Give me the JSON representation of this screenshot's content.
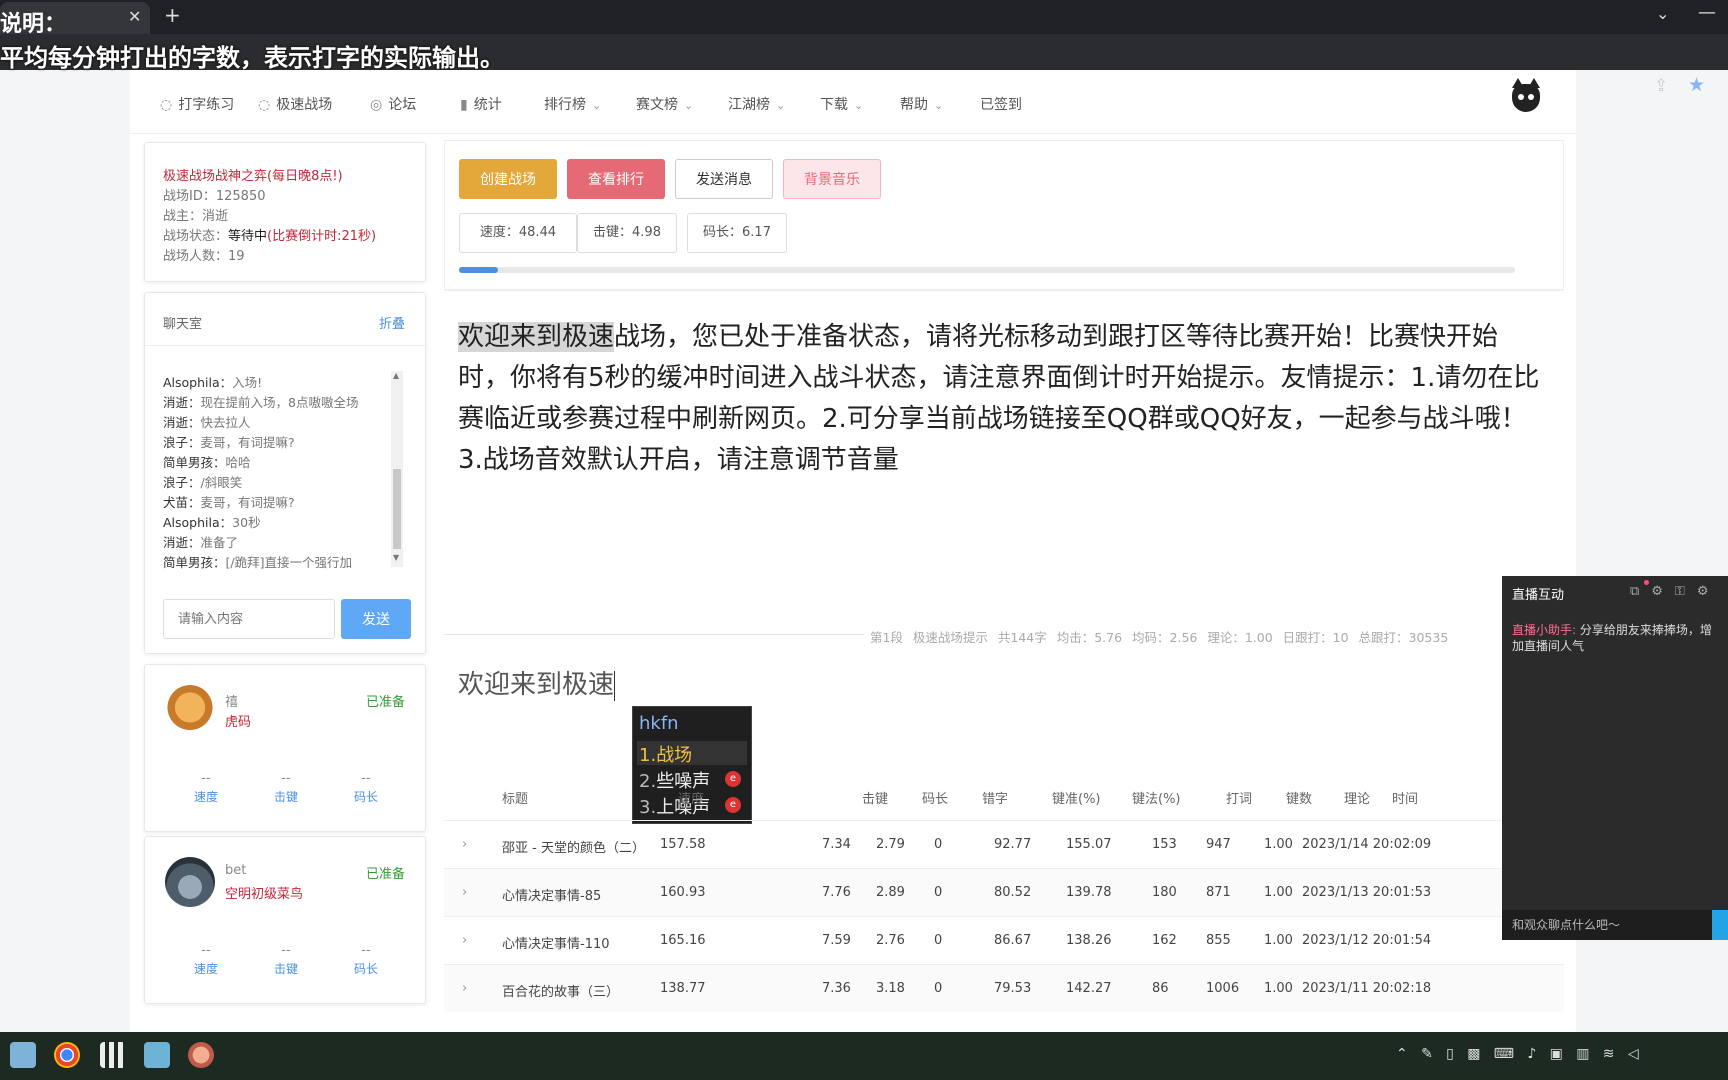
{
  "browser": {
    "tab_title": "说明：",
    "overlay_subtitle": "平均每分钟打出的字数，表示打字的实际输出。",
    "new_tab": "+",
    "close": "✕"
  },
  "nav": {
    "items": [
      {
        "label": "打字练习",
        "icon": "◌"
      },
      {
        "label": "极速战场",
        "icon": "◌"
      },
      {
        "label": "论坛",
        "icon": "◎"
      },
      {
        "label": "统计",
        "icon": "▮"
      },
      {
        "label": "排行榜",
        "chev": true
      },
      {
        "label": "赛文榜",
        "chev": true
      },
      {
        "label": "江湖榜",
        "chev": true
      },
      {
        "label": "下载",
        "chev": true
      },
      {
        "label": "帮助",
        "chev": true
      },
      {
        "label": "已签到"
      }
    ]
  },
  "battle": {
    "name": "极速战场战神之弈(每日晚8点!)",
    "id_label": "战场ID：",
    "id_value": "125850",
    "owner_label": "战主：",
    "owner_value": "消逝",
    "status_label": "战场状态：",
    "status_value": "等待中",
    "countdown": "(比赛倒计时:21秒)",
    "count_label": "战场人数：",
    "count_value": "19"
  },
  "chat": {
    "title": "聊天室",
    "fold": "折叠",
    "messages": [
      {
        "who": "Alsophila",
        "text": "入场!"
      },
      {
        "who": "消逝",
        "text": "现在提前入场，8点嗷嗷全场"
      },
      {
        "who": "消逝",
        "text": "快去拉人"
      },
      {
        "who": "浪子",
        "text": "麦哥，有词提嘛?"
      },
      {
        "who": "简单男孩",
        "text": "哈哈"
      },
      {
        "who": "浪子",
        "text": "/斜眼笑"
      },
      {
        "who": "犬苗",
        "text": "麦哥，有词提嘛?"
      },
      {
        "who": "Alsophila",
        "text": "30秒"
      },
      {
        "who": "消逝",
        "text": "准备了"
      },
      {
        "who": "简单男孩",
        "text": "[/跪拜]直接一个强行加"
      }
    ],
    "input_placeholder": "请输入内容",
    "send": "发送"
  },
  "players": [
    {
      "name": "禧",
      "title": "虎码",
      "status": "已准备",
      "speed": "--",
      "keystroke": "--",
      "code_len": "--"
    },
    {
      "name": "bet",
      "title": "空明初级菜鸟",
      "status": "已准备",
      "speed": "--",
      "keystroke": "--",
      "code_len": "--"
    }
  ],
  "player_stat_labels": {
    "speed": "速度",
    "keystroke": "击键",
    "code_len": "码长"
  },
  "actions": {
    "create": "创建战场",
    "rank": "查看排行",
    "message": "发送消息",
    "music": "背景音乐"
  },
  "metrics": {
    "speed": "速度：48.44",
    "keystroke": "击键：4.98",
    "code_len": "码长：6.17"
  },
  "progress": 0.037,
  "article": {
    "typed": "欢迎来到极速",
    "rest": "战场，您已处于准备状态，请将光标移动到跟打区等待比赛开始！比赛快开始时，你将有5秒的缓冲时间进入战斗状态，请注意界面倒计时开始提示。友情提示：1.请勿在比赛临近或参赛过程中刷新网页。2.可分享当前战场链接至QQ群或QQ好友，一起参与战斗哦！3.战场音效默认开启，请注意调节音量",
    "meta": "第1段  极速战场提示  共144字  均击：5.76  均码：2.56  理论：1.00  日跟打：10  总跟打：30535"
  },
  "typing": {
    "text": "欢迎来到极速"
  },
  "ime": {
    "input": "hkfn",
    "candidates": [
      {
        "n": "1.",
        "text": "战场"
      },
      {
        "n": "2.",
        "text": "些噪声"
      },
      {
        "n": "3.",
        "text": "上噪声"
      }
    ]
  },
  "table": {
    "headers": [
      "标题",
      "速度",
      "击键",
      "码长",
      "错字",
      "键准(%)",
      "键法(%)",
      "打词",
      "键数",
      "理论",
      "时间"
    ],
    "rows": [
      [
        "邵亚 - 天堂的颜色（二）",
        "157.58",
        "7.34",
        "2.79",
        "0",
        "92.77",
        "155.07",
        "153",
        "947",
        "1.00",
        "2023/1/14 20:02:09"
      ],
      [
        "心情决定事情-85",
        "160.93",
        "7.76",
        "2.89",
        "0",
        "80.52",
        "139.78",
        "180",
        "871",
        "1.00",
        "2023/1/13 20:01:53"
      ],
      [
        "心情决定事情-110",
        "165.16",
        "7.59",
        "2.76",
        "0",
        "86.67",
        "138.26",
        "162",
        "855",
        "1.00",
        "2023/1/12 20:01:54"
      ],
      [
        "百合花的故事（三）",
        "138.77",
        "7.36",
        "3.18",
        "0",
        "79.53",
        "142.27",
        "86",
        "1006",
        "1.00",
        "2023/1/11 20:02:18"
      ]
    ]
  },
  "live": {
    "title": "直播互动",
    "msg_who": "直播小助手:",
    "msg_text": "分享给朋友来捧捧场，增加直播间人气",
    "input_placeholder": "和观众聊点什么吧～"
  },
  "colors": {
    "accent_blue": "#4a90e2",
    "create": "#e3a73a",
    "rank": "#e56a75",
    "ready_green": "#3a9a3a",
    "title_red": "#c2283a"
  }
}
